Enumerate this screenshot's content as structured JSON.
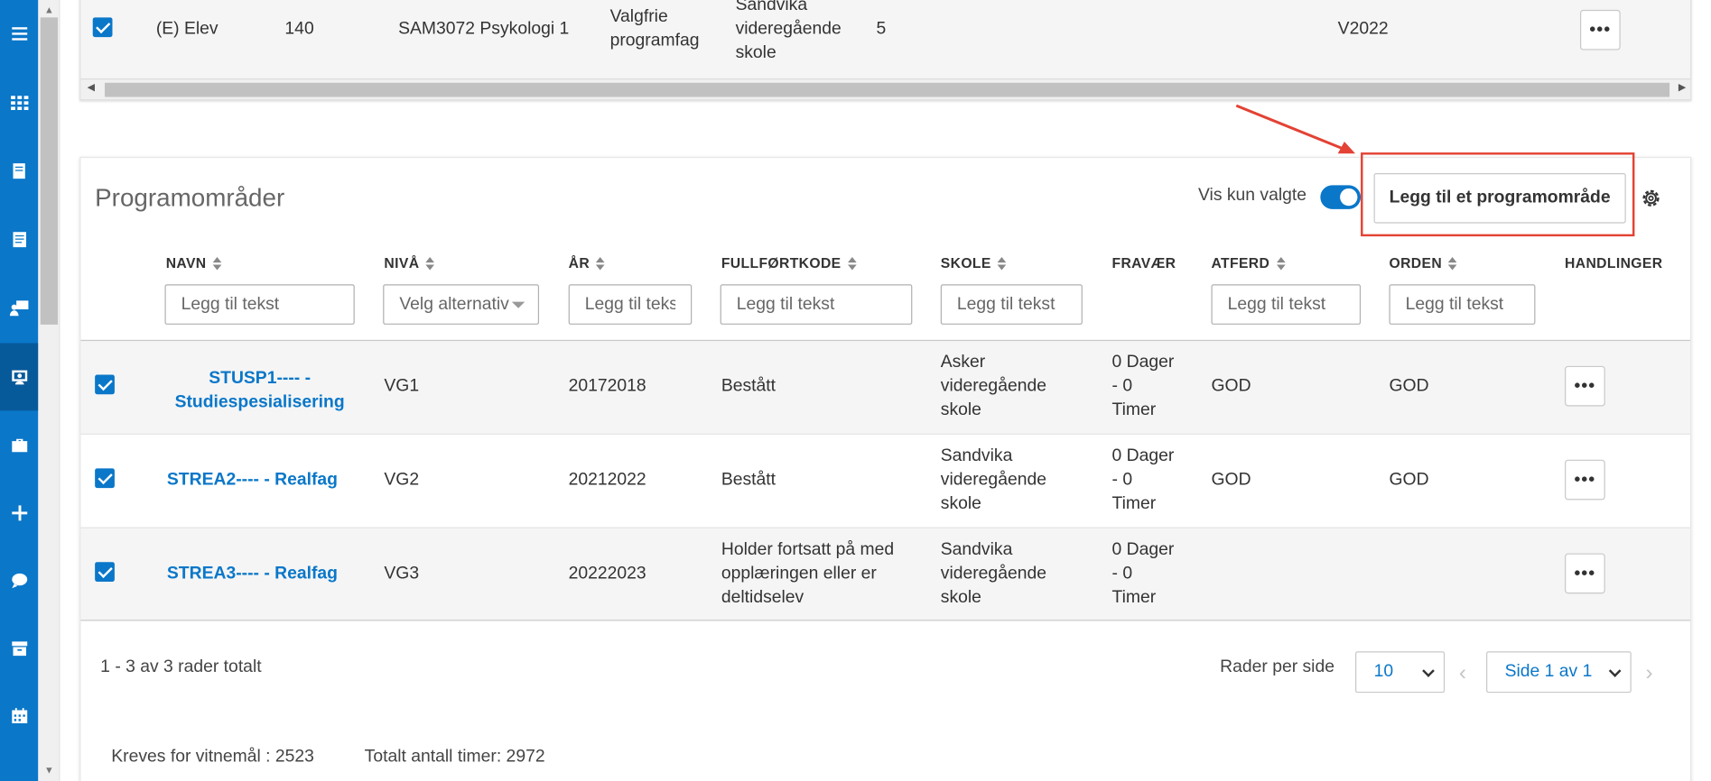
{
  "nav": {
    "items": [
      "menu",
      "apps",
      "book",
      "book-open",
      "teacher",
      "students",
      "briefcase",
      "plus",
      "chat",
      "archive",
      "calendar"
    ],
    "active_index": 5
  },
  "top_table": {
    "row": {
      "checked": true,
      "type": "(E) Elev",
      "number": "140",
      "subject": "SAM3072 Psykologi 1",
      "category": "Valgfrie programfag",
      "school": "Sandvika videregående skole",
      "hours": "5",
      "term": "V2022"
    }
  },
  "programomrader": {
    "title": "Programområder",
    "toggle_label": "Vis kun valgte",
    "toggle_on": true,
    "add_button": "Legg til et programområde",
    "columns": {
      "navn": "NAVN",
      "niva": "NIVÅ",
      "ar": "ÅR",
      "fullfortkode": "FULLFØRTKODE",
      "skole": "SKOLE",
      "fravaer": "FRAVÆR",
      "atferd": "ATFERD",
      "orden": "ORDEN",
      "handlinger": "HANDLINGER"
    },
    "filters": {
      "navn": "Legg til tekst",
      "niva": "Velg alternativ",
      "ar": "Legg til tekst",
      "fullfortkode": "Legg til tekst",
      "skole": "Legg til tekst",
      "atferd": "Legg til tekst",
      "orden": "Legg til tekst"
    },
    "rows": [
      {
        "checked": true,
        "navn_line1": "STUSP1---- -",
        "navn_line2": "Studiespesialisering",
        "niva": "VG1",
        "ar": "20172018",
        "fullfortkode": "Bestått",
        "skole_1": "Asker",
        "skole_2": "videregående",
        "skole_3": "skole",
        "fravaer_1": "0 Dager",
        "fravaer_2": "- 0",
        "fravaer_3": "Timer",
        "atferd": "GOD",
        "orden": "GOD"
      },
      {
        "checked": true,
        "navn": "STREA2---- - Realfag",
        "niva": "VG2",
        "ar": "20212022",
        "fullfortkode": "Bestått",
        "skole_1": "Sandvika",
        "skole_2": "videregående",
        "skole_3": "skole",
        "fravaer_1": "0 Dager",
        "fravaer_2": "- 0",
        "fravaer_3": "Timer",
        "atferd": "GOD",
        "orden": "GOD"
      },
      {
        "checked": true,
        "navn": "STREA3---- - Realfag",
        "niva": "VG3",
        "ar": "20222023",
        "fullfortkode_1": "Holder fortsatt på med",
        "fullfortkode_2": "opplæringen eller er",
        "fullfortkode_3": "deltidselev",
        "skole_1": "Sandvika",
        "skole_2": "videregående",
        "skole_3": "skole",
        "fravaer_1": "0 Dager",
        "fravaer_2": "- 0",
        "fravaer_3": "Timer",
        "atferd": "",
        "orden": ""
      }
    ],
    "footer": {
      "count_text": "1 - 3 av 3 rader totalt",
      "rows_per_page_label": "Rader per side",
      "rows_per_page_value": "10",
      "page_label": "Side 1 av 1"
    }
  },
  "summary": {
    "kreves": "Kreves for vitnemål : 2523",
    "totalt": "Totalt antall timer: 2972"
  },
  "colors": {
    "nav_bg": "#0a77c9",
    "nav_active": "#075a9a",
    "accent": "#0a77c9",
    "annotation": "#e34234"
  }
}
